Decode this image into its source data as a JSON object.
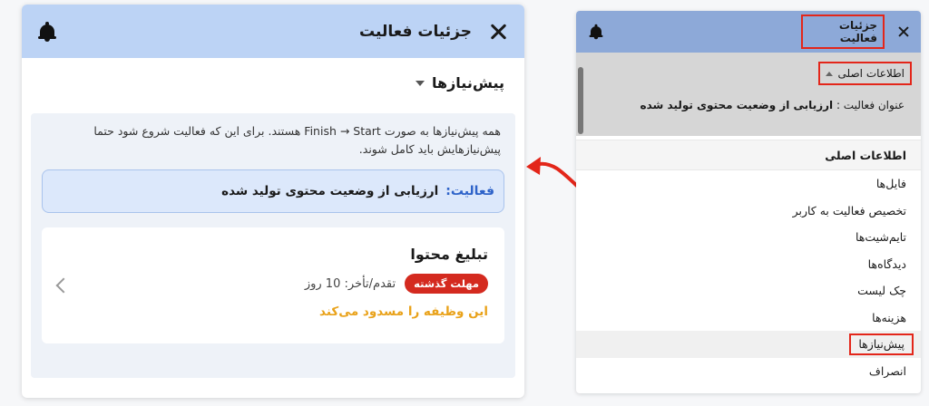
{
  "left_panel": {
    "title": "جزئیات فعالیت",
    "section_title": "پیش‌نیازها",
    "info_text": "همه پیش‌نیازها به صورت Finish → Start هستند. برای این که فعالیت شروع شود حتما پیش‌نیازهایش باید کامل شوند.",
    "activity_label": "فعالیت:",
    "activity_value": "ارزیابی از وضعیت محتوی تولید شده",
    "card": {
      "title": "تبلیغ محتوا",
      "badge": "مهلت گذشته",
      "delay": "تقدم/تأخر: 10 روز",
      "blocked": "این وظیفه را مسدود می‌کند"
    }
  },
  "right_panel": {
    "title": "جزئیات فعالیت",
    "main_info_toggle": "اطلاعات اصلی",
    "field_label": "عنوان فعالیت :",
    "field_value": "ارزیابی از وضعیت محتوی تولید شده",
    "section_head": "اطلاعات اصلی",
    "menu": [
      "فایل‌ها",
      "تخصیص فعالیت به کاربر",
      "تایم‌شیت‌ها",
      "دیدگاه‌ها",
      "چک لیست",
      "هزینه‌ها",
      "پیش‌نیازها",
      "انصراف"
    ]
  },
  "colors": {
    "accent_red": "#e3261a",
    "badge_red": "#d42a1f",
    "warning_orange": "#e9a21a",
    "header_blue_light": "#bcd3f5",
    "header_blue": "#8da9d8",
    "activity_blue": "#2e63c9"
  }
}
